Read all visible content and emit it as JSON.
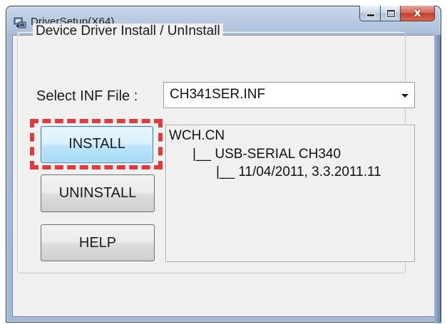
{
  "window": {
    "title": "DriverSetup(X64)",
    "app_icon": "driver-setup-icon",
    "caption_buttons": {
      "minimize": "minimize-icon",
      "maximize": "maximize-icon",
      "close_glyph": "x"
    }
  },
  "group": {
    "title": "Device Driver Install / UnInstall"
  },
  "inf": {
    "label": "Select INF File :",
    "selected": "CH341SER.INF"
  },
  "buttons": {
    "install": "INSTALL",
    "uninstall": "UNINSTALL",
    "help": "HELP"
  },
  "info": {
    "line1": "WCH.CN",
    "line2": "|__ USB-SERIAL CH340",
    "line3": "|__ 11/04/2011, 3.3.2011.11"
  },
  "colors": {
    "highlight": "#e03a3a",
    "install_focus": "#3c7fb1",
    "close_button": "#c33c2c"
  }
}
